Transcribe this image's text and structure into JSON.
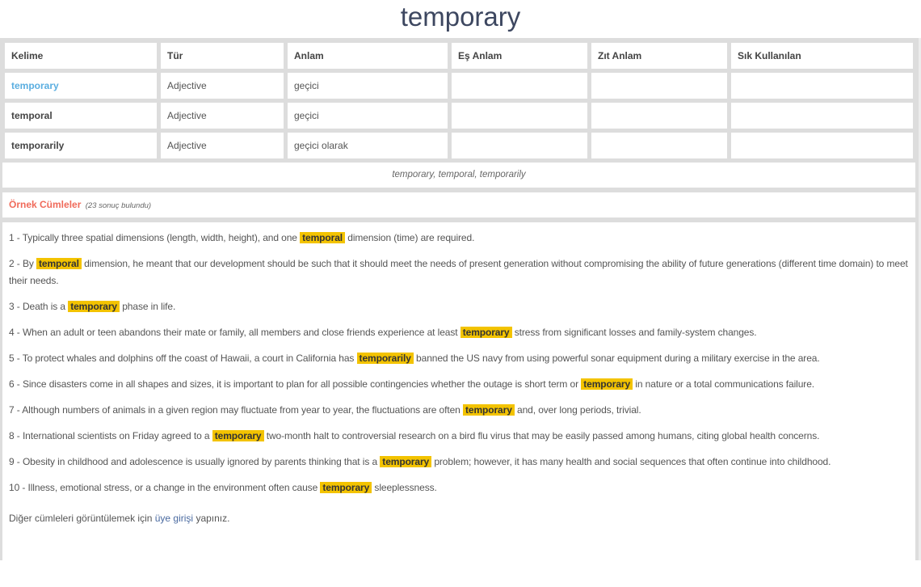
{
  "title": "temporary",
  "table": {
    "headers": [
      "Kelime",
      "Tür",
      "Anlam",
      "Eş Anlam",
      "Zıt Anlam",
      "Sık Kullanılan"
    ],
    "rows": [
      {
        "word": "temporary",
        "type": "Adjective",
        "meaning": "geçici",
        "synonym": "",
        "antonym": "",
        "frequent": "",
        "active": true
      },
      {
        "word": "temporal",
        "type": "Adjective",
        "meaning": "geçici",
        "synonym": "",
        "antonym": "",
        "frequent": "",
        "active": false
      },
      {
        "word": "temporarily",
        "type": "Adjective",
        "meaning": "geçici olarak",
        "synonym": "",
        "antonym": "",
        "frequent": "",
        "active": false
      }
    ]
  },
  "forms_line": "temporary, temporal, temporarily",
  "examples": {
    "title": "Örnek Cümleler",
    "count_text": "(23 sonuç bulundu)",
    "sentences": [
      {
        "before": "1 - Typically three spatial dimensions (length, width, height), and one",
        "highlight": "temporal",
        "after": "dimension (time) are required."
      },
      {
        "before": "2 - By",
        "highlight": "temporal",
        "after": "dimension, he meant that our development should be such that it should meet the needs of present generation without compromising the ability of future generations (different time domain) to meet their needs."
      },
      {
        "before": "3 - Death is a",
        "highlight": "temporary",
        "after": "phase in life."
      },
      {
        "before": "4 - When an adult or teen abandons their mate or family, all members and close friends experience at least",
        "highlight": "temporary",
        "after": "stress from significant losses and family-system changes."
      },
      {
        "before": "5 - To protect whales and dolphins off the coast of Hawaii, a court in California has",
        "highlight": "temporarily",
        "after": "banned the US navy from using powerful sonar equipment during a military exercise in the area."
      },
      {
        "before": "6 - Since disasters come in all shapes and sizes, it is important to plan for all possible contingencies whether the outage is short term or",
        "highlight": "temporary",
        "after": "in nature or a total communications failure."
      },
      {
        "before": "7 - Although numbers of animals in a given region may fluctuate from year to year, the fluctuations are often",
        "highlight": "temporary",
        "after": "and, over long periods, trivial."
      },
      {
        "before": "8 - International scientists on Friday agreed to a",
        "highlight": "temporary",
        "after": "two-month halt to controversial research on a bird flu virus that may be easily passed among humans, citing global health concerns."
      },
      {
        "before": "9 - Obesity in childhood and adolescence is usually ignored by parents thinking that is a",
        "highlight": "temporary",
        "after": "problem; however, it has many health and social sequences that often continue into childhood."
      },
      {
        "before": "10 - Illness, emotional stress, or a change in the environment often cause",
        "highlight": "temporary",
        "after": "sleeplessness."
      }
    ],
    "footer": {
      "before": "Diğer cümleleri görüntülemek için",
      "link": "üye girişi",
      "after": "yapınız."
    }
  },
  "colors": {
    "title": "#3d4760",
    "active_word": "#5aaee0",
    "section_title": "#f06a5a",
    "highlight": "#f3c300",
    "link": "#4a6aa0",
    "frame": "#dddddd"
  }
}
